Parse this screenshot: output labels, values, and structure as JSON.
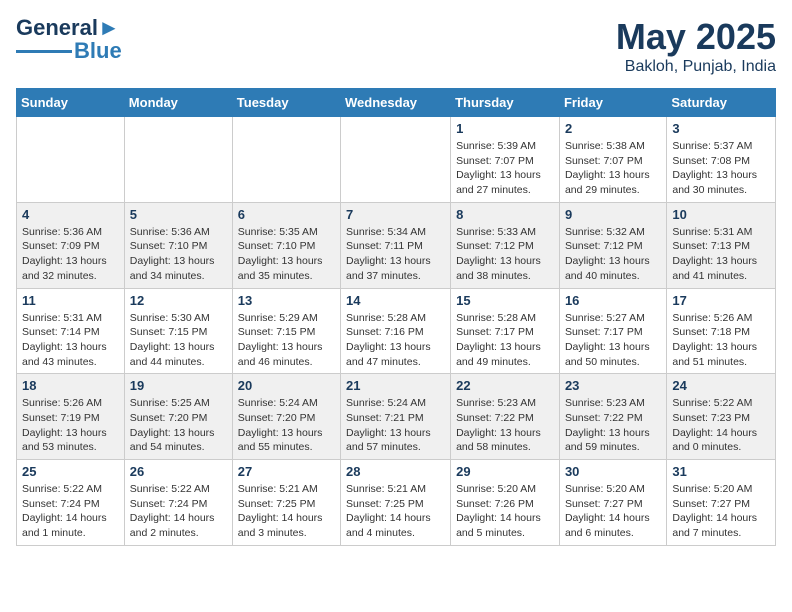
{
  "header": {
    "logo_line1": "General",
    "logo_line2": "Blue",
    "month": "May 2025",
    "location": "Bakloh, Punjab, India"
  },
  "weekdays": [
    "Sunday",
    "Monday",
    "Tuesday",
    "Wednesday",
    "Thursday",
    "Friday",
    "Saturday"
  ],
  "weeks": [
    [
      {
        "day": "",
        "info": ""
      },
      {
        "day": "",
        "info": ""
      },
      {
        "day": "",
        "info": ""
      },
      {
        "day": "",
        "info": ""
      },
      {
        "day": "1",
        "info": "Sunrise: 5:39 AM\nSunset: 7:07 PM\nDaylight: 13 hours\nand 27 minutes."
      },
      {
        "day": "2",
        "info": "Sunrise: 5:38 AM\nSunset: 7:07 PM\nDaylight: 13 hours\nand 29 minutes."
      },
      {
        "day": "3",
        "info": "Sunrise: 5:37 AM\nSunset: 7:08 PM\nDaylight: 13 hours\nand 30 minutes."
      }
    ],
    [
      {
        "day": "4",
        "info": "Sunrise: 5:36 AM\nSunset: 7:09 PM\nDaylight: 13 hours\nand 32 minutes."
      },
      {
        "day": "5",
        "info": "Sunrise: 5:36 AM\nSunset: 7:10 PM\nDaylight: 13 hours\nand 34 minutes."
      },
      {
        "day": "6",
        "info": "Sunrise: 5:35 AM\nSunset: 7:10 PM\nDaylight: 13 hours\nand 35 minutes."
      },
      {
        "day": "7",
        "info": "Sunrise: 5:34 AM\nSunset: 7:11 PM\nDaylight: 13 hours\nand 37 minutes."
      },
      {
        "day": "8",
        "info": "Sunrise: 5:33 AM\nSunset: 7:12 PM\nDaylight: 13 hours\nand 38 minutes."
      },
      {
        "day": "9",
        "info": "Sunrise: 5:32 AM\nSunset: 7:12 PM\nDaylight: 13 hours\nand 40 minutes."
      },
      {
        "day": "10",
        "info": "Sunrise: 5:31 AM\nSunset: 7:13 PM\nDaylight: 13 hours\nand 41 minutes."
      }
    ],
    [
      {
        "day": "11",
        "info": "Sunrise: 5:31 AM\nSunset: 7:14 PM\nDaylight: 13 hours\nand 43 minutes."
      },
      {
        "day": "12",
        "info": "Sunrise: 5:30 AM\nSunset: 7:15 PM\nDaylight: 13 hours\nand 44 minutes."
      },
      {
        "day": "13",
        "info": "Sunrise: 5:29 AM\nSunset: 7:15 PM\nDaylight: 13 hours\nand 46 minutes."
      },
      {
        "day": "14",
        "info": "Sunrise: 5:28 AM\nSunset: 7:16 PM\nDaylight: 13 hours\nand 47 minutes."
      },
      {
        "day": "15",
        "info": "Sunrise: 5:28 AM\nSunset: 7:17 PM\nDaylight: 13 hours\nand 49 minutes."
      },
      {
        "day": "16",
        "info": "Sunrise: 5:27 AM\nSunset: 7:17 PM\nDaylight: 13 hours\nand 50 minutes."
      },
      {
        "day": "17",
        "info": "Sunrise: 5:26 AM\nSunset: 7:18 PM\nDaylight: 13 hours\nand 51 minutes."
      }
    ],
    [
      {
        "day": "18",
        "info": "Sunrise: 5:26 AM\nSunset: 7:19 PM\nDaylight: 13 hours\nand 53 minutes."
      },
      {
        "day": "19",
        "info": "Sunrise: 5:25 AM\nSunset: 7:20 PM\nDaylight: 13 hours\nand 54 minutes."
      },
      {
        "day": "20",
        "info": "Sunrise: 5:24 AM\nSunset: 7:20 PM\nDaylight: 13 hours\nand 55 minutes."
      },
      {
        "day": "21",
        "info": "Sunrise: 5:24 AM\nSunset: 7:21 PM\nDaylight: 13 hours\nand 57 minutes."
      },
      {
        "day": "22",
        "info": "Sunrise: 5:23 AM\nSunset: 7:22 PM\nDaylight: 13 hours\nand 58 minutes."
      },
      {
        "day": "23",
        "info": "Sunrise: 5:23 AM\nSunset: 7:22 PM\nDaylight: 13 hours\nand 59 minutes."
      },
      {
        "day": "24",
        "info": "Sunrise: 5:22 AM\nSunset: 7:23 PM\nDaylight: 14 hours\nand 0 minutes."
      }
    ],
    [
      {
        "day": "25",
        "info": "Sunrise: 5:22 AM\nSunset: 7:24 PM\nDaylight: 14 hours\nand 1 minute."
      },
      {
        "day": "26",
        "info": "Sunrise: 5:22 AM\nSunset: 7:24 PM\nDaylight: 14 hours\nand 2 minutes."
      },
      {
        "day": "27",
        "info": "Sunrise: 5:21 AM\nSunset: 7:25 PM\nDaylight: 14 hours\nand 3 minutes."
      },
      {
        "day": "28",
        "info": "Sunrise: 5:21 AM\nSunset: 7:25 PM\nDaylight: 14 hours\nand 4 minutes."
      },
      {
        "day": "29",
        "info": "Sunrise: 5:20 AM\nSunset: 7:26 PM\nDaylight: 14 hours\nand 5 minutes."
      },
      {
        "day": "30",
        "info": "Sunrise: 5:20 AM\nSunset: 7:27 PM\nDaylight: 14 hours\nand 6 minutes."
      },
      {
        "day": "31",
        "info": "Sunrise: 5:20 AM\nSunset: 7:27 PM\nDaylight: 14 hours\nand 7 minutes."
      }
    ]
  ]
}
